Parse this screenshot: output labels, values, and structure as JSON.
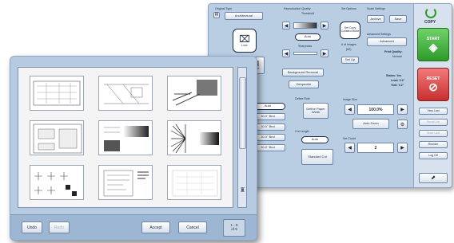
{
  "back_panel": {
    "original_type": {
      "label": "Original Type",
      "value": "Architectural"
    },
    "line_label": "Line",
    "print_label": "Print",
    "reproduction_quality": {
      "label": "Reproduction Quality",
      "threshold": "Threshold",
      "mode": "Auto",
      "sharpness": "Sharpness"
    },
    "background_removal": "Background Removal",
    "despeckle": "Despeckle",
    "set_options": {
      "label": "Set Options",
      "collated": "Set Copy Collated Mode",
      "images_label": "# of Images",
      "images_value": "(62)",
      "set_up": "Set Up"
    },
    "scale_settings": {
      "label": "Scale Settings",
      "a": "Archive",
      "b": "Save"
    },
    "advanced": {
      "label": "Advanced Settings",
      "button": "Advanced"
    },
    "print_quality": {
      "label": "Print Quality:",
      "value": "Normal"
    },
    "status": {
      "line1": "Status: Yes",
      "line2": "Lead: 0.2\"",
      "line3": "Trail: 0.2\""
    },
    "media_rows": [
      "Auto",
      "30.0\" Bnd",
      "30.0\" Bnd",
      "30.0\" Bnd",
      "30.0\" Bnd"
    ],
    "define_rule": {
      "label": "Define Rule",
      "button": "Define Paper Width"
    },
    "cut_length": {
      "label": "Cut Length",
      "mode": "Auto",
      "button": "Standard Cut"
    },
    "image_size": {
      "label": "Image Size",
      "value": "100.0%",
      "zoom": "Auto Zoom"
    },
    "set_count": {
      "label": "Set Count",
      "value": "2"
    },
    "side": {
      "copy": "COPY",
      "start": "START",
      "reset": "RESET",
      "buttons": [
        "View Last",
        "Recall Job",
        "Store Last",
        "Reorder",
        "Log Off"
      ]
    }
  },
  "front_panel": {
    "footer": {
      "undo": "Undo",
      "redo": "Redo",
      "accept": "Accept",
      "cancel": "Cancel",
      "pager_top": "1 - 9",
      "pager_bottom": "of 9"
    }
  },
  "colors": {
    "panel_blue": "#b6cbe2",
    "start_green": "#2f9a2a",
    "reset_red": "#c62f2f",
    "frame": "#7d93b2"
  }
}
